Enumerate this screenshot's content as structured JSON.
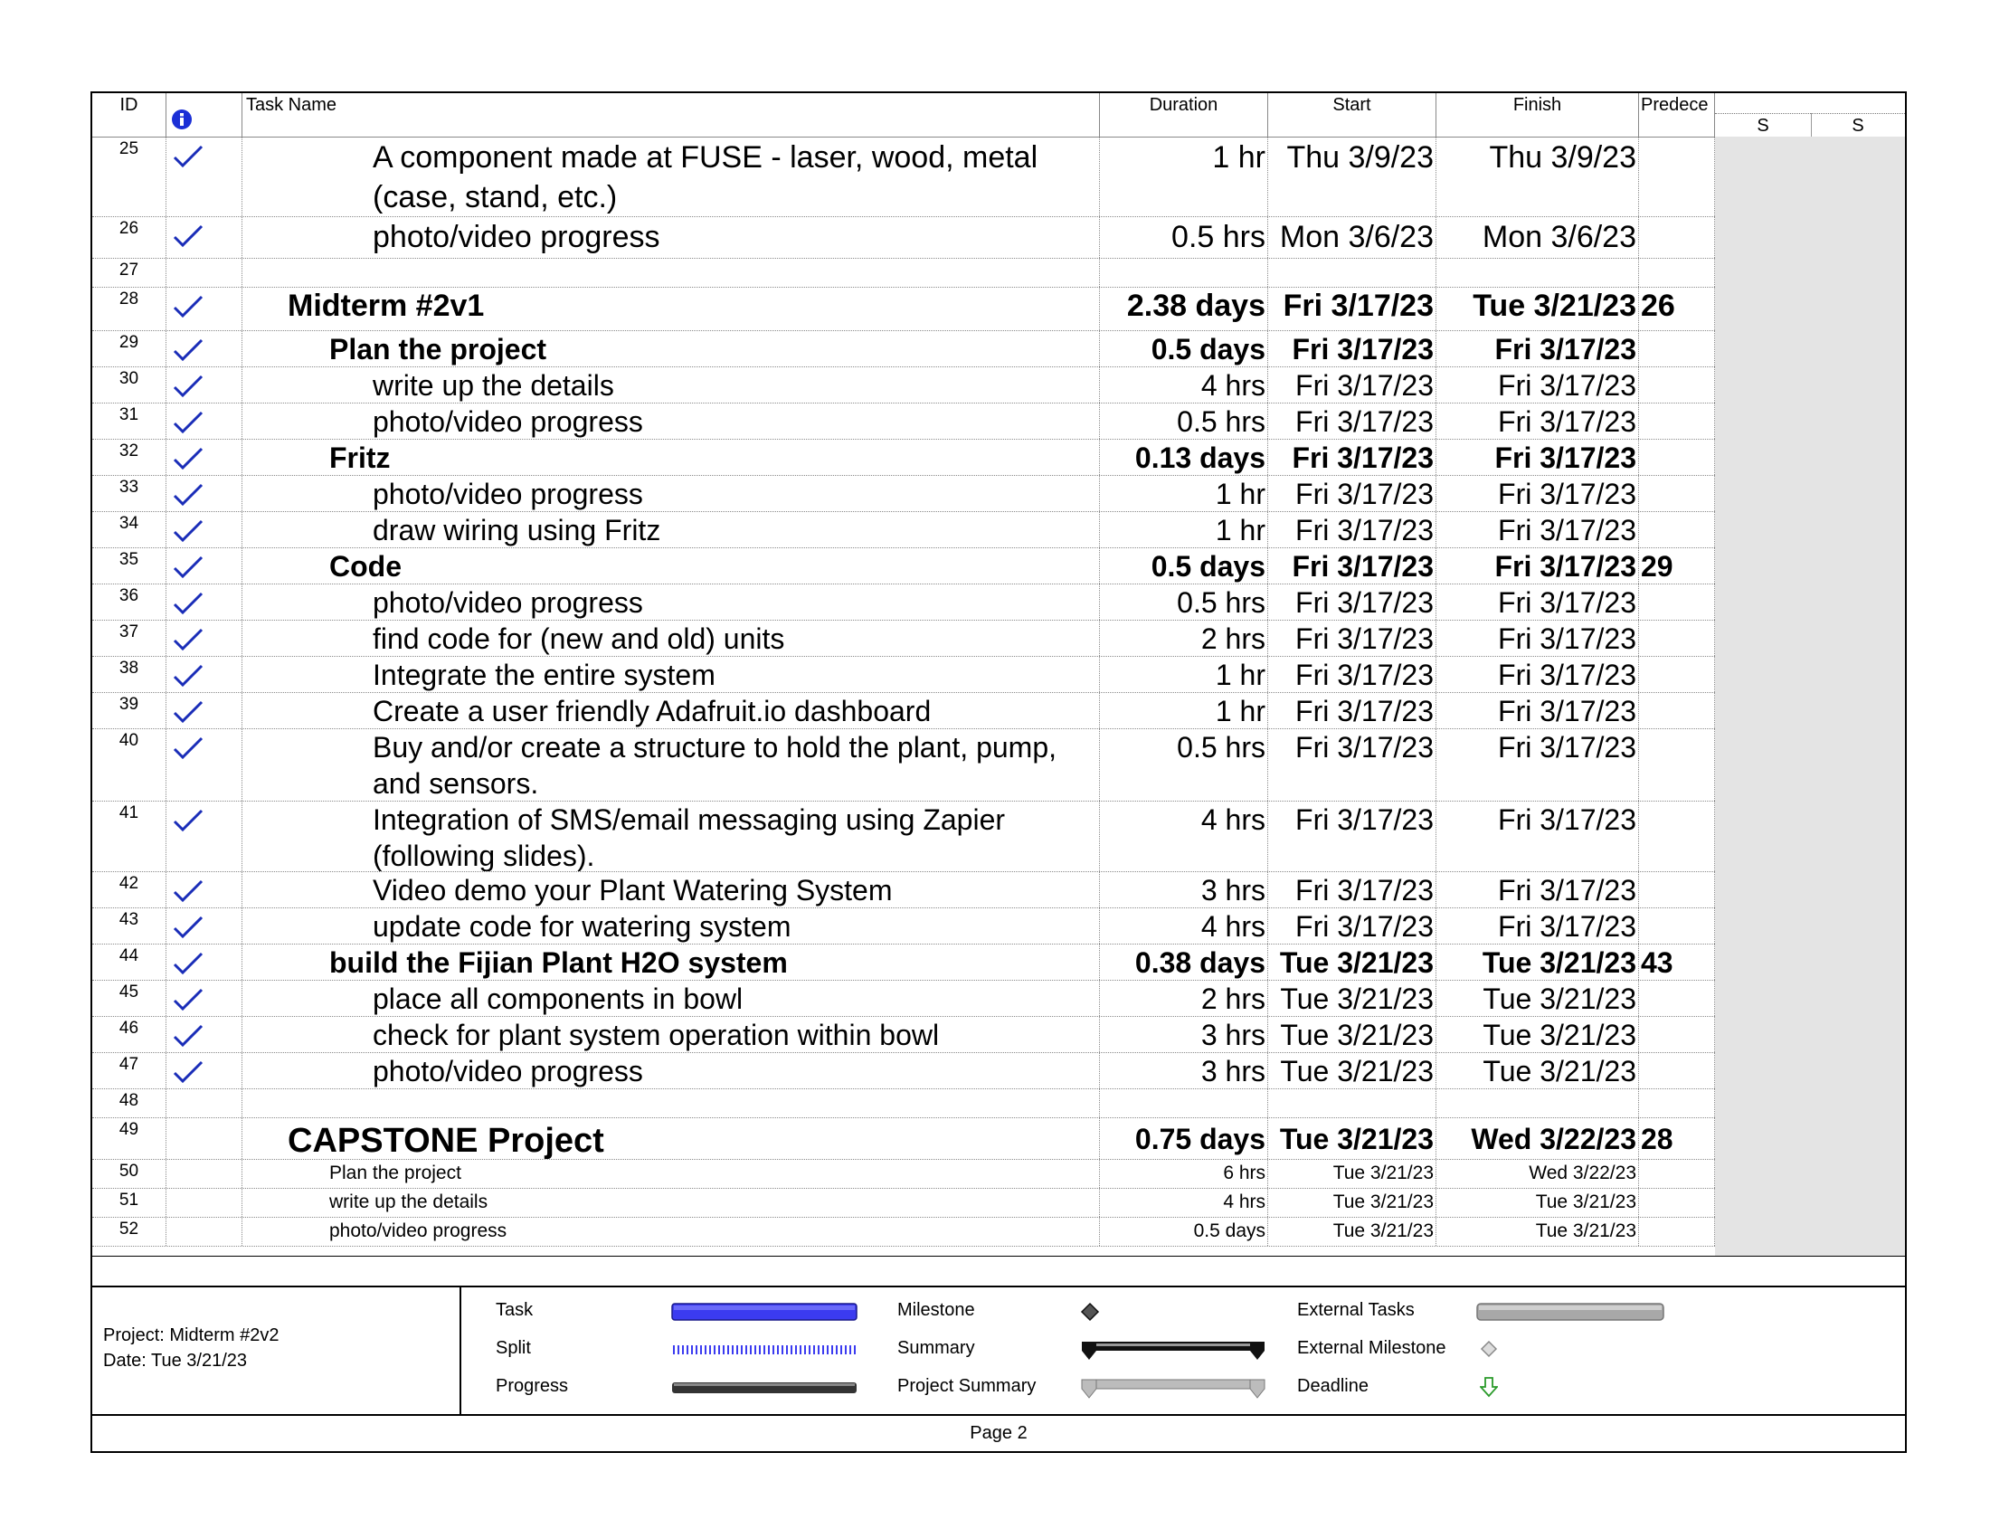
{
  "columns": {
    "id": "ID",
    "task_name": "Task Name",
    "duration": "Duration",
    "start": "Start",
    "finish": "Finish",
    "predecessors": "Predece",
    "info_icon": "info-icon",
    "timescale_days": [
      "S",
      "S"
    ]
  },
  "rows": [
    {
      "id": "25",
      "check": true,
      "name": "A component made at FUSE - laser, wood, metal (case, stand, etc.)",
      "duration": "1 hr",
      "start": "Thu 3/9/23",
      "finish": "Thu 3/9/23",
      "pred": ""
    },
    {
      "id": "26",
      "check": true,
      "name": "photo/video progress",
      "duration": "0.5 hrs",
      "start": "Mon 3/6/23",
      "finish": "Mon 3/6/23",
      "pred": ""
    },
    {
      "id": "27",
      "check": false,
      "name": "",
      "duration": "",
      "start": "",
      "finish": "",
      "pred": ""
    },
    {
      "id": "28",
      "check": true,
      "name": "Midterm #2v1",
      "duration": "2.38 days",
      "start": "Fri 3/17/23",
      "finish": "Tue 3/21/23",
      "pred": "26"
    },
    {
      "id": "29",
      "check": true,
      "name": "Plan the project",
      "duration": "0.5 days",
      "start": "Fri 3/17/23",
      "finish": "Fri 3/17/23",
      "pred": ""
    },
    {
      "id": "30",
      "check": true,
      "name": "write up the details",
      "duration": "4 hrs",
      "start": "Fri 3/17/23",
      "finish": "Fri 3/17/23",
      "pred": ""
    },
    {
      "id": "31",
      "check": true,
      "name": "photo/video progress",
      "duration": "0.5 hrs",
      "start": "Fri 3/17/23",
      "finish": "Fri 3/17/23",
      "pred": ""
    },
    {
      "id": "32",
      "check": true,
      "name": "Fritz",
      "duration": "0.13 days",
      "start": "Fri 3/17/23",
      "finish": "Fri 3/17/23",
      "pred": ""
    },
    {
      "id": "33",
      "check": true,
      "name": "photo/video progress",
      "duration": "1 hr",
      "start": "Fri 3/17/23",
      "finish": "Fri 3/17/23",
      "pred": ""
    },
    {
      "id": "34",
      "check": true,
      "name": "draw wiring using Fritz",
      "duration": "1 hr",
      "start": "Fri 3/17/23",
      "finish": "Fri 3/17/23",
      "pred": ""
    },
    {
      "id": "35",
      "check": true,
      "name": "Code",
      "duration": "0.5 days",
      "start": "Fri 3/17/23",
      "finish": "Fri 3/17/23",
      "pred": "29"
    },
    {
      "id": "36",
      "check": true,
      "name": "photo/video progress",
      "duration": "0.5 hrs",
      "start": "Fri 3/17/23",
      "finish": "Fri 3/17/23",
      "pred": ""
    },
    {
      "id": "37",
      "check": true,
      "name": "find code for (new and old) units",
      "duration": "2 hrs",
      "start": "Fri 3/17/23",
      "finish": "Fri 3/17/23",
      "pred": ""
    },
    {
      "id": "38",
      "check": true,
      "name": "Integrate the entire system",
      "duration": "1 hr",
      "start": "Fri 3/17/23",
      "finish": "Fri 3/17/23",
      "pred": ""
    },
    {
      "id": "39",
      "check": true,
      "name": "Create a user friendly Adafruit.io dashboard",
      "duration": "1 hr",
      "start": "Fri 3/17/23",
      "finish": "Fri 3/17/23",
      "pred": ""
    },
    {
      "id": "40",
      "check": true,
      "name": "Buy and/or create a structure to hold the plant, pump, and sensors.",
      "duration": "0.5 hrs",
      "start": "Fri 3/17/23",
      "finish": "Fri 3/17/23",
      "pred": ""
    },
    {
      "id": "41",
      "check": true,
      "name": "Integration of SMS/email messaging using Zapier (following slides).",
      "duration": "4 hrs",
      "start": "Fri 3/17/23",
      "finish": "Fri 3/17/23",
      "pred": ""
    },
    {
      "id": "42",
      "check": true,
      "name": "Video demo your Plant Watering System",
      "duration": "3 hrs",
      "start": "Fri 3/17/23",
      "finish": "Fri 3/17/23",
      "pred": ""
    },
    {
      "id": "43",
      "check": true,
      "name": "update code for watering system",
      "duration": "4 hrs",
      "start": "Fri 3/17/23",
      "finish": "Fri 3/17/23",
      "pred": ""
    },
    {
      "id": "44",
      "check": true,
      "name": "build the Fijian Plant H2O system",
      "duration": "0.38 days",
      "start": "Tue 3/21/23",
      "finish": "Tue 3/21/23",
      "pred": "43"
    },
    {
      "id": "45",
      "check": true,
      "name": "place all components in bowl",
      "duration": "2 hrs",
      "start": "Tue 3/21/23",
      "finish": "Tue 3/21/23",
      "pred": ""
    },
    {
      "id": "46",
      "check": true,
      "name": "check for plant system operation within bowl",
      "duration": "3 hrs",
      "start": "Tue 3/21/23",
      "finish": "Tue 3/21/23",
      "pred": ""
    },
    {
      "id": "47",
      "check": true,
      "name": "photo/video progress",
      "duration": "3 hrs",
      "start": "Tue 3/21/23",
      "finish": "Tue 3/21/23",
      "pred": ""
    },
    {
      "id": "48",
      "check": false,
      "name": "",
      "duration": "",
      "start": "",
      "finish": "",
      "pred": ""
    },
    {
      "id": "49",
      "check": false,
      "name": "CAPSTONE Project",
      "duration": "0.75 days",
      "start": "Tue 3/21/23",
      "finish": "Wed 3/22/23",
      "pred": "28"
    },
    {
      "id": "50",
      "check": false,
      "name": "Plan the project",
      "duration": "6 hrs",
      "start": "Tue 3/21/23",
      "finish": "Wed 3/22/23",
      "pred": ""
    },
    {
      "id": "51",
      "check": false,
      "name": "write up the details",
      "duration": "4 hrs",
      "start": "Tue 3/21/23",
      "finish": "Tue 3/21/23",
      "pred": ""
    },
    {
      "id": "52",
      "check": false,
      "name": "photo/video progress",
      "duration": "0.5 days",
      "start": "Tue 3/21/23",
      "finish": "Tue 3/21/23",
      "pred": ""
    }
  ],
  "legend": {
    "project": "Project: Midterm #2v2",
    "date": "Date: Tue 3/21/23",
    "task": "Task",
    "split": "Split",
    "progress": "Progress",
    "milestone": "Milestone",
    "summary": "Summary",
    "project_summary": "Project Summary",
    "external_tasks": "External Tasks",
    "external_milestone": "External Milestone",
    "deadline": "Deadline",
    "colors": {
      "task": "#3b3bf0",
      "split": "#3b3bf0",
      "progress": "#333333",
      "summary": "#111111",
      "project_summary": "#bcbcbc",
      "external_tasks": "#a8a8a8",
      "deadline": "#2a9a2a"
    }
  },
  "footer": {
    "page": "Page 2"
  }
}
